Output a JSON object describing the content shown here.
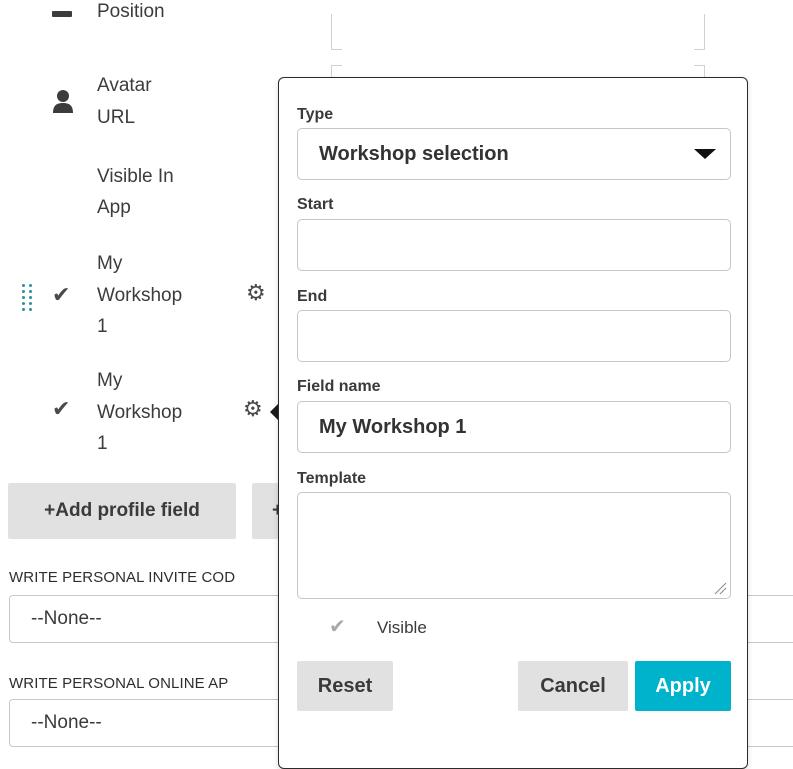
{
  "profile_fields": {
    "position_label_partial": "Position",
    "avatar_label_line1": "Avatar",
    "avatar_label_line2": "URL",
    "visible_in_app_line1": "Visible In",
    "visible_in_app_line2": "App",
    "workshop_a": {
      "line1": "My",
      "line2": "Workshop",
      "line3": "1"
    },
    "workshop_b": {
      "line1": "My",
      "line2": "Workshop",
      "line3": "1"
    }
  },
  "actions": {
    "add_profile_field": "+Add profile field",
    "second_button_partial": "+"
  },
  "invite_code": {
    "label": "WRITE PERSONAL INVITE COD",
    "value": "--None--"
  },
  "online_app": {
    "label": "WRITE PERSONAL ONLINE AP",
    "value": "--None--"
  },
  "popover": {
    "type_label": "Type",
    "type_value": "Workshop selection",
    "start_label": "Start",
    "start_value": "",
    "end_label": "End",
    "end_value": "",
    "field_name_label": "Field name",
    "field_name_value": "My Workshop 1",
    "template_label": "Template",
    "template_value": "",
    "visible_label": "Visible",
    "visible_checked": true,
    "reset_label": "Reset",
    "cancel_label": "Cancel",
    "apply_label": "Apply"
  },
  "colors": {
    "accent": "#00b3cc",
    "button_gray": "#e1e1e1",
    "drag_handle": "#2e8fa0"
  }
}
